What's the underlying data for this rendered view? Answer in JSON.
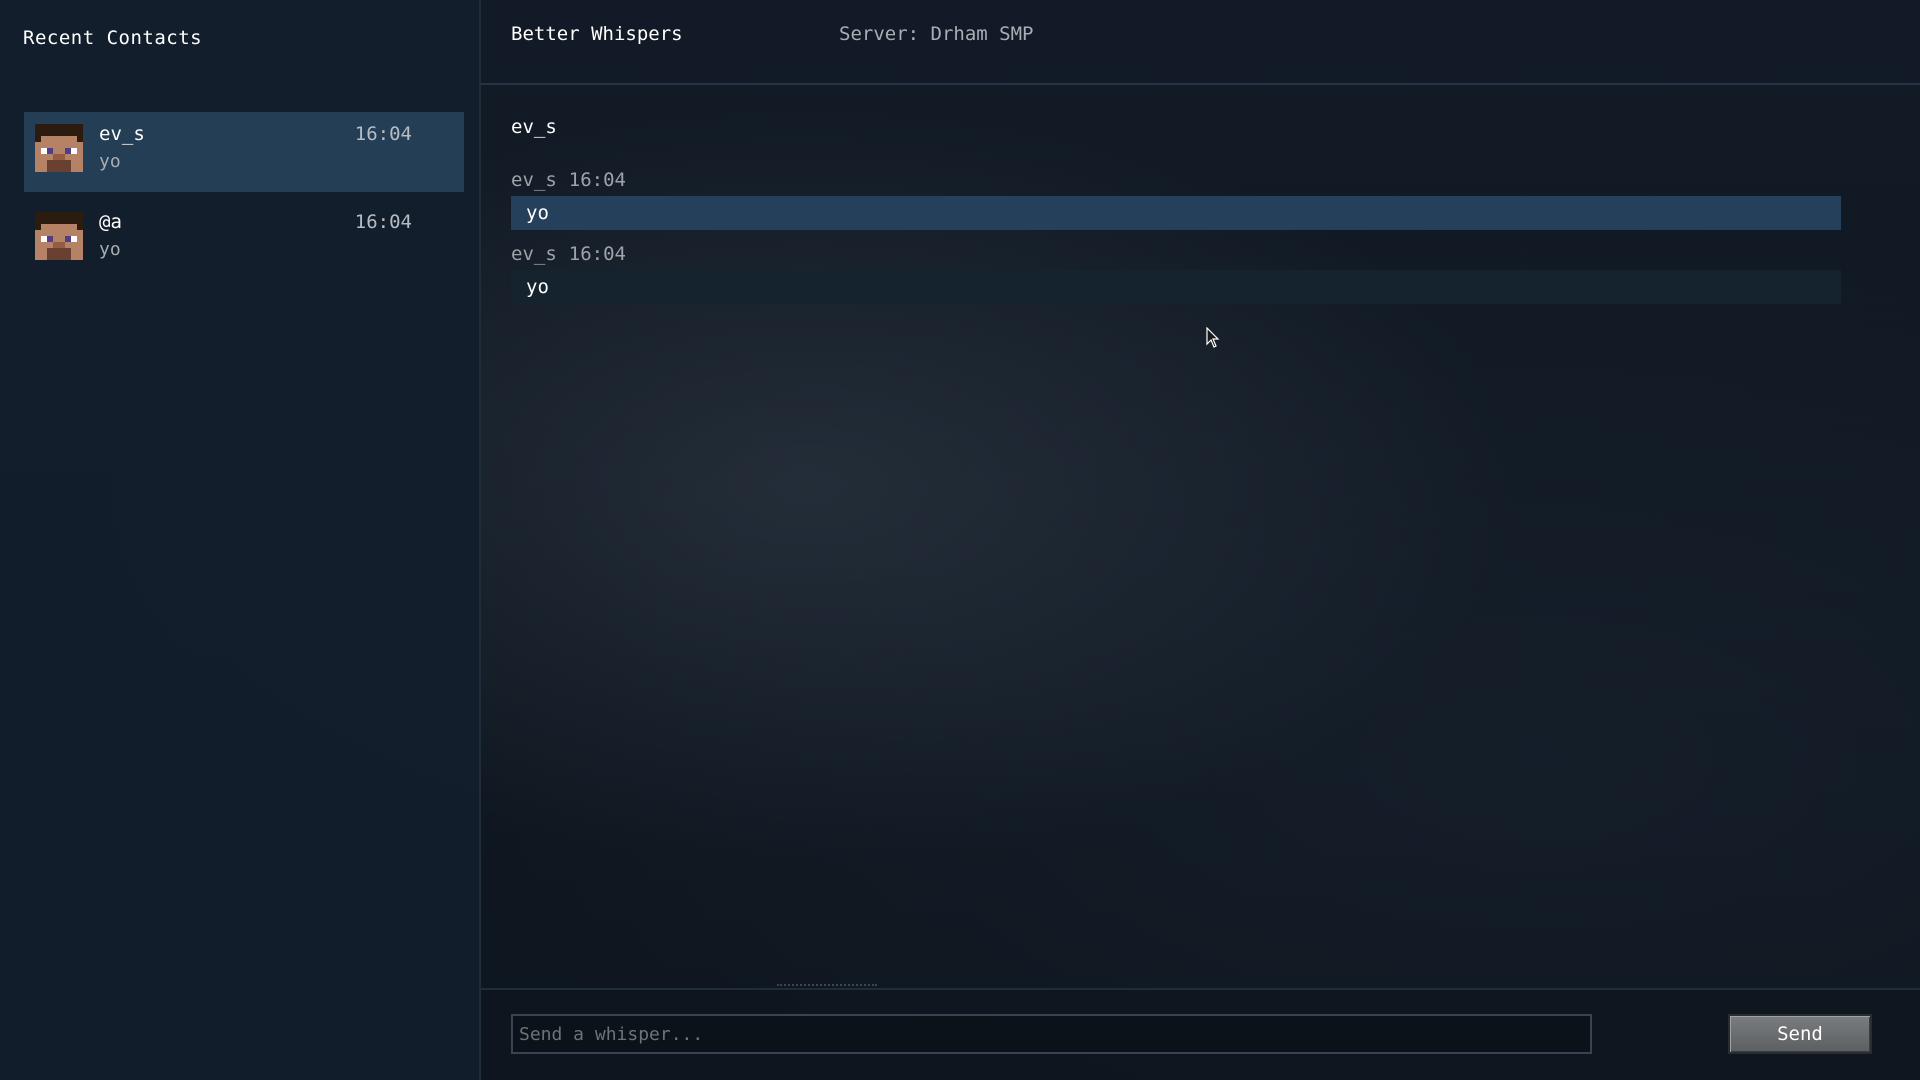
{
  "sidebar": {
    "title": "Recent Contacts",
    "contacts": [
      {
        "name": "ev_s",
        "time": "16:04",
        "preview": "yo",
        "selected": true
      },
      {
        "name": "@a",
        "time": "16:04",
        "preview": "yo",
        "selected": false
      }
    ]
  },
  "header": {
    "app_title": "Better Whispers",
    "server_label": "Server: Drham SMP"
  },
  "conversation": {
    "name": "ev_s",
    "messages": [
      {
        "sender": "ev_s",
        "time": "16:04",
        "text": "yo",
        "highlighted": true
      },
      {
        "sender": "ev_s",
        "time": "16:04",
        "text": "yo",
        "highlighted": false
      }
    ]
  },
  "composer": {
    "placeholder": "Send a whisper...",
    "value": "",
    "send_label": "Send"
  },
  "colors": {
    "selected_contact_bg": "#243e56",
    "highlight_message_bg": "#24405a",
    "message_bg": "#15232f",
    "send_button": "#6b6e71"
  },
  "icons": {
    "avatar": "player-head-icon",
    "cursor": "mouse-pointer-icon"
  }
}
